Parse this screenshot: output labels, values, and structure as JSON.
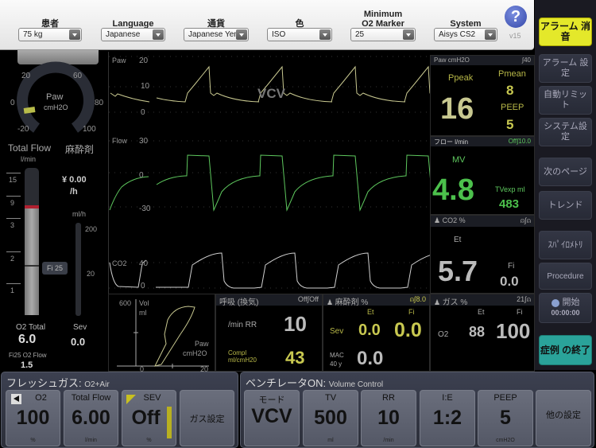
{
  "settings": {
    "patient": {
      "label": "患者",
      "value": "75 kg"
    },
    "language": {
      "label": "Language",
      "value": "Japanese"
    },
    "currency": {
      "label": "通貨",
      "value": "Japanese Yen"
    },
    "color": {
      "label": "色",
      "value": "ISO"
    },
    "o2marker": {
      "label": "Minimum\nO2 Marker",
      "label1": "Minimum",
      "label2": "O2 Marker",
      "value": "25"
    },
    "system": {
      "label": "System",
      "value": "Aisys CS2"
    },
    "help": "?",
    "version": "v15"
  },
  "side": {
    "silence": "アラーム 消音",
    "alarm_settings": "アラーム 設定",
    "auto_limits": "自動リミット",
    "system_settings": "システム設定",
    "next_page": "次のページ",
    "trend": "トレンド",
    "spirometry": "ｽﾊﾟｲﾛﾒﾄﾘ",
    "procedure": "Procedure",
    "start": "開始",
    "timer": "00:00:00",
    "end_case": "症例 の終了"
  },
  "gauge": {
    "label": "Paw",
    "unit": "cmH2O",
    "ticks": [
      "20",
      "60",
      "0",
      "80",
      "-20",
      "100"
    ],
    "value": 5
  },
  "flowmeter": {
    "title": "Total Flow",
    "unit": "l/min",
    "ticks": [
      "15",
      "9",
      "3",
      "2",
      "1"
    ],
    "fi_marker": "Fi 25",
    "o2_total_label": "O2 Total",
    "o2_total": "6.0",
    "fi25_label": "Fi25 O2 Flow",
    "fi25_value": "1.5"
  },
  "agent": {
    "title": "麻酔剤",
    "cost": "¥ 0.00",
    "cost_unit": "/h",
    "rate_unit": "ml/h",
    "ticks": [
      "200",
      "20"
    ],
    "sev_label": "Sev",
    "sev_value": "0.0"
  },
  "waves": {
    "paw": {
      "label": "Paw",
      "ticks": [
        "20",
        "10",
        "0"
      ],
      "mode": "VCV"
    },
    "flow": {
      "label": "Flow",
      "ticks": [
        "30",
        "0",
        "-30"
      ]
    },
    "co2": {
      "label": "CO2",
      "ticks": [
        "40",
        "0"
      ]
    }
  },
  "loop": {
    "y_label": "Vol",
    "y_unit": "ml",
    "y_max": "600",
    "x_label": "Paw",
    "x_unit": "cmH2O",
    "x_min": "0",
    "x_max": "20"
  },
  "paw_panel": {
    "header": "Paw cmH2O",
    "limit": "∫40",
    "ppeak_label": "Ppeak",
    "ppeak": "16",
    "pmean_label": "Pmean",
    "pmean": "8",
    "peep_label": "PEEP",
    "peep": "5"
  },
  "flow_panel": {
    "header": "フロー l/min",
    "limit": "Off∫10.0",
    "mv_label": "MV",
    "mv": "4.8",
    "tvexp_label": "TVexp ml",
    "tvexp": "483"
  },
  "co2_panel": {
    "header": "CO2 %",
    "et_label": "Et",
    "et": "5.7",
    "fi_label": "Fi",
    "fi": "0.0"
  },
  "resp_panel": {
    "header": "呼吸 (換気)",
    "limit": "Off∫Off",
    "rr_label": "/min RR",
    "rr": "10",
    "compl_label1": "Compl",
    "compl_label2": "ml/cmH20",
    "compl": "43"
  },
  "agent_panel": {
    "header": "麻酔剤 %",
    "limit": "∫8.0",
    "et_label": "Et",
    "fi_label": "Fi",
    "sev_label": "Sev",
    "sev_et": "0.0",
    "sev_fi": "0.0",
    "mac_label1": "MAC",
    "mac_label2": "40 y",
    "mac": "0.0"
  },
  "gas_panel": {
    "header": "ガス %",
    "limit": "21∫",
    "et_label": "Et",
    "fi_label": "Fi",
    "o2_label": "O2",
    "o2_et": "88",
    "o2_fi": "100"
  },
  "fresh_gas": {
    "title": "フレッシュガス:",
    "subtitle": "O2+Air",
    "tiles": [
      {
        "label": "O2",
        "value": "100",
        "unit": "%"
      },
      {
        "label": "Total Flow",
        "value": "6.00",
        "unit": "l/min"
      },
      {
        "label": "SEV",
        "value": "Off",
        "unit": "%"
      }
    ],
    "gas_settings": "ガス設定"
  },
  "ventilator": {
    "title": "ベンチレータON:",
    "subtitle": "Volume Control",
    "tiles": [
      {
        "label": "モード",
        "value": "VCV",
        "unit": ""
      },
      {
        "label": "TV",
        "value": "500",
        "unit": "ml"
      },
      {
        "label": "RR",
        "value": "10",
        "unit": "/min"
      },
      {
        "label": "I:E",
        "value": "1:2",
        "unit": ""
      },
      {
        "label": "PEEP",
        "value": "5",
        "unit": "cmH2O"
      }
    ],
    "other_settings": "他の設定"
  },
  "colors": {
    "paw": "#c8c890",
    "flow": "#5ec85e",
    "co2": "#d0d0d0",
    "accent_yellow": "#e4e82a",
    "accent_teal": "#2aa39a"
  }
}
